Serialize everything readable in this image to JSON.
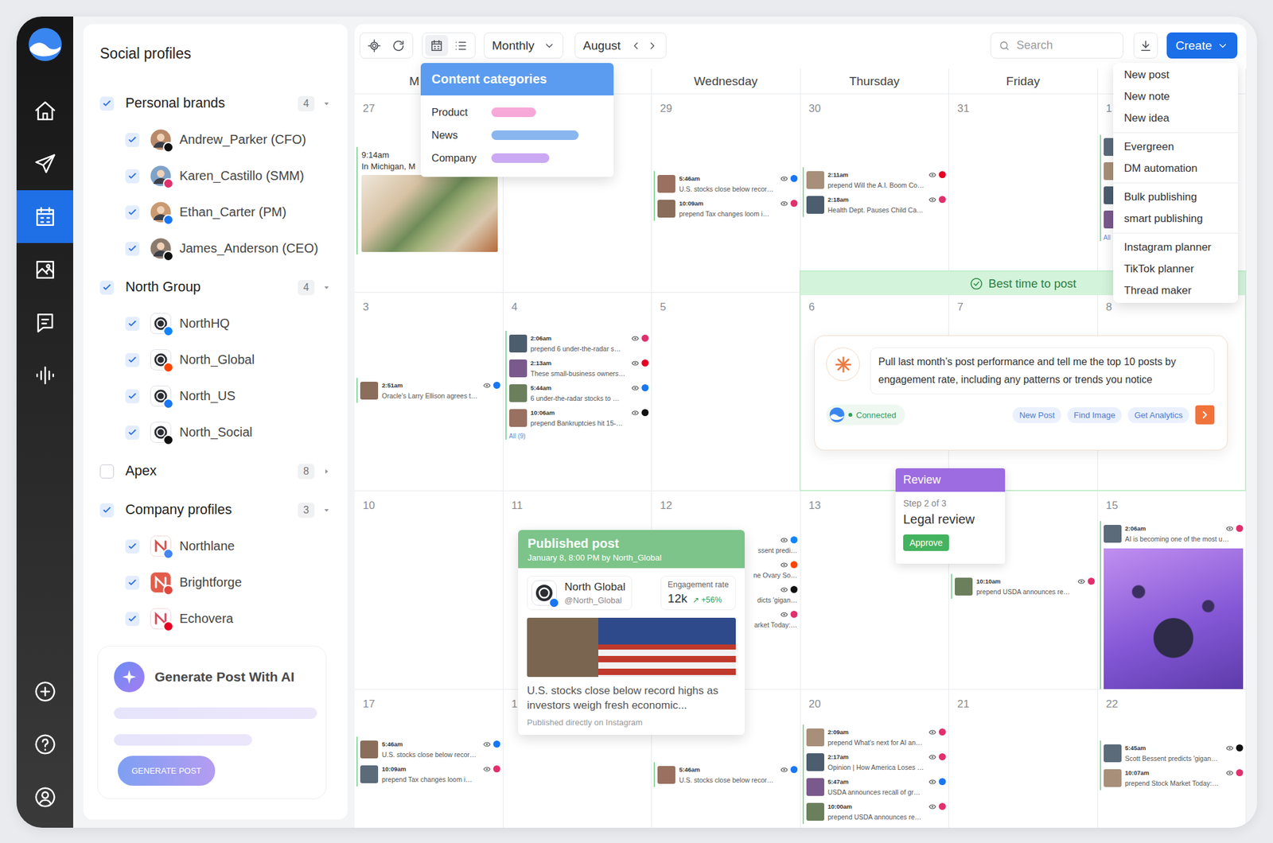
{
  "nav": {
    "top": [
      {
        "selected": false
      },
      {
        "selected": false
      },
      {
        "selected": true
      },
      {
        "selected": false
      },
      {
        "selected": false
      },
      {
        "selected": false
      }
    ],
    "bottom": [
      {
        "selected": false
      },
      {
        "selected": false
      },
      {
        "selected": false
      }
    ]
  },
  "sidebar": {
    "title": "Social profiles",
    "groups": [
      {
        "label": "Personal brands",
        "count": "4",
        "checked": true,
        "expanded": true,
        "profiles": [
          {
            "name": "Andrew_Parker (CFO)",
            "kind": "person",
            "checked": true,
            "badge_color": "#111111"
          },
          {
            "name": "Karen_Castillo (SMM)",
            "kind": "person",
            "checked": true,
            "badge_color": "#e1306c"
          },
          {
            "name": "Ethan_Carter (PM)",
            "kind": "person",
            "checked": true,
            "badge_color": "#1877f2"
          },
          {
            "name": "James_Anderson (CEO)",
            "kind": "person",
            "checked": true,
            "badge_color": "#111111"
          }
        ]
      },
      {
        "label": "North Group",
        "count": "4",
        "checked": true,
        "expanded": true,
        "profiles": [
          {
            "name": "NorthHQ",
            "kind": "brand",
            "checked": true,
            "badge_color": "#1185fe"
          },
          {
            "name": "North_Global",
            "kind": "brand",
            "checked": true,
            "badge_color": "#ff4500"
          },
          {
            "name": "North_US",
            "kind": "brand",
            "checked": true,
            "badge_color": "#1877f2"
          },
          {
            "name": "North_Social",
            "kind": "brand",
            "checked": true,
            "badge_color": "#111111"
          }
        ]
      },
      {
        "label": "Apex",
        "count": "8",
        "checked": false,
        "expanded": false,
        "profiles": []
      },
      {
        "label": "Company profiles",
        "count": "3",
        "checked": true,
        "expanded": true,
        "profiles": [
          {
            "name": "Northlane",
            "kind": "company",
            "checked": true,
            "badge_color": "#4285f4"
          },
          {
            "name": "Brightforge",
            "kind": "company",
            "checked": true,
            "badge_color": "#e0483e"
          },
          {
            "name": "Echovera",
            "kind": "company",
            "checked": true,
            "badge_color": "#e60023"
          }
        ]
      }
    ],
    "ai_card": {
      "title": "Generate Post With AI",
      "button": "GENERATE POST"
    }
  },
  "toolbar": {
    "view_buttons": [
      {
        "selected": true
      },
      {
        "selected": false
      }
    ],
    "view_mode": "Monthly",
    "month": "August",
    "search_placeholder": "Search",
    "create_label": "Create"
  },
  "calendar": {
    "headers": [
      "M",
      "",
      "Wednesday",
      "Thursday",
      "Friday",
      ""
    ],
    "weeks": [
      [
        {
          "date": "27",
          "posts": [
            {
              "kind": "card",
              "time": "9:14am",
              "text": "In Michigan, M"
            }
          ]
        },
        {
          "posts": []
        },
        {
          "date": "29",
          "posts": [
            {
              "kind": "line",
              "time": "5:46am",
              "text": "U.S. stocks close below recor…",
              "badge_color": "#1877f2"
            },
            {
              "kind": "line",
              "time": "10:09am",
              "text": "prepend Tax changes loom i…",
              "badge_color": "#e1306c"
            }
          ]
        },
        {
          "date": "30",
          "posts": [
            {
              "kind": "line",
              "time": "2:11am",
              "text": "prepend Will the A.I. Boom Co…",
              "badge_color": "#e60023"
            },
            {
              "kind": "line",
              "time": "2:18am",
              "text": "Health Dept. Pauses Child Ca…",
              "badge_color": "#e1306c"
            }
          ]
        },
        {
          "date": "31",
          "posts": []
        },
        {
          "date": "1",
          "posts": [
            {
              "kind": "thumb"
            },
            {
              "kind": "thumb"
            },
            {
              "kind": "thumb"
            },
            {
              "kind": "thumb"
            }
          ],
          "more": "All"
        }
      ],
      [
        {
          "date": "3",
          "posts": [
            {
              "kind": "line",
              "time": "2:51am",
              "text": "Oracle's Larry Ellison agrees t…",
              "badge_color": "#1877f2"
            }
          ]
        },
        {
          "date": "4",
          "posts": [
            {
              "kind": "line",
              "time": "2:06am",
              "text": "prepend 6 under-the-radar s…",
              "badge_color": "#e1306c"
            },
            {
              "kind": "line",
              "time": "2:13am",
              "text": "These small-business owners…",
              "badge_color": "#e60023"
            },
            {
              "kind": "line",
              "time": "5:44am",
              "text": "6 under-the-radar stocks to …",
              "badge_color": "#1877f2"
            },
            {
              "kind": "line",
              "time": "10:06am",
              "text": "prepend Bankruptcies hit 15-…",
              "badge_color": "#111111"
            }
          ],
          "more": "All (9)"
        },
        {
          "date": "5",
          "posts": []
        },
        {
          "date": "6",
          "posts": []
        },
        {
          "date": "7",
          "posts": []
        },
        {
          "date": "8",
          "posts": []
        }
      ],
      [
        {
          "date": "10",
          "posts": []
        },
        {
          "date": "11",
          "posts": []
        },
        {
          "date": "12",
          "posts": [
            {
              "kind": "clipped",
              "text": "ssent predi…",
              "badge_color": "#1185fe"
            },
            {
              "kind": "clipped",
              "text": "ne Ovary So…",
              "badge_color": "#ff4500"
            },
            {
              "kind": "clipped",
              "text": "dicts 'gigan…",
              "badge_color": "#111111"
            },
            {
              "kind": "clipped",
              "text": "arket Today:…",
              "badge_color": "#e1306c"
            }
          ]
        },
        {
          "date": "13",
          "posts": []
        },
        {
          "posts": [
            {
              "kind": "line",
              "time": "10:10am",
              "text": "prepend USDA announces re…",
              "badge_color": "#e1306c"
            }
          ]
        },
        {
          "date": "15",
          "posts": [
            {
              "kind": "feature",
              "time": "2:06am",
              "text": "AI is becoming one of the most u…",
              "badge_color": "#e1306c"
            }
          ]
        }
      ],
      [
        {
          "date": "17",
          "posts": [
            {
              "kind": "line",
              "time": "5:46am",
              "text": "U.S. stocks close below recor…",
              "badge_color": "#1877f2"
            },
            {
              "kind": "line",
              "time": "10:09am",
              "text": "prepend Tax changes loom i…",
              "badge_color": "#e1306c"
            }
          ]
        },
        {
          "date": "1",
          "posts": []
        },
        {
          "posts": [
            {
              "kind": "line",
              "time": "5:46am",
              "text": "U.S. stocks close below recor…",
              "badge_color": "#1877f2"
            }
          ]
        },
        {
          "date": "20",
          "posts": [
            {
              "kind": "line",
              "time": "2:09am",
              "text": "prepend What's next for AI an…",
              "badge_color": "#e1306c"
            },
            {
              "kind": "line",
              "time": "2:17am",
              "text": "Opinion | How America Loses …",
              "badge_color": "#e1306c"
            },
            {
              "kind": "line",
              "time": "5:47am",
              "text": "USDA announces recall of gr…",
              "badge_color": "#1877f2"
            },
            {
              "kind": "line",
              "time": "10:00am",
              "text": "prepend USDA announces re…",
              "badge_color": "#e1306c"
            }
          ]
        },
        {
          "date": "21",
          "posts": []
        },
        {
          "date": "22",
          "posts": [
            {
              "kind": "line",
              "time": "5:45am",
              "text": "Scott Bessent predicts 'gigan…",
              "badge_color": "#111111"
            },
            {
              "kind": "line",
              "time": "10:07am",
              "text": "prepend Stock Market Today:…",
              "badge_color": "#e1306c"
            }
          ]
        }
      ]
    ]
  },
  "categories": {
    "title": "Content categories",
    "items": [
      {
        "label": "Product",
        "color": "#f7a8d9",
        "level": 0.4
      },
      {
        "label": "News",
        "color": "#8ab6f0",
        "level": 0.78
      },
      {
        "label": "Company",
        "color": "#caa8f3",
        "level": 0.52
      }
    ]
  },
  "create_menu": [
    [
      "New post",
      "New note",
      "New idea"
    ],
    [
      "Evergreen",
      "DM automation"
    ],
    [
      "Bulk publishing",
      "smart publishing"
    ],
    [
      "Instagram planner",
      "TikTok planner",
      "Thread maker"
    ]
  ],
  "best_time": {
    "label": "Best time to post"
  },
  "ai_prompt": {
    "text": "Pull last month’s post performance and tell me the top 10 posts by engagement rate, including any patterns or trends you notice",
    "status": "Connected",
    "connected": true,
    "chips": [
      "New Post",
      "Find Image",
      "Get Analytics"
    ]
  },
  "review": {
    "header": "Review",
    "step": "Step 2 of 3",
    "title": "Legal review",
    "button": "Approve"
  },
  "published": {
    "header": "Published post",
    "meta": "January 8, 8:00 PM by North_Global",
    "account": "North Global",
    "handle": "@North_Global",
    "badge_color": "#1877f2",
    "metric_label": "Engagement rate",
    "metric_value": "12k",
    "metric_change": "↗ +56%",
    "text": "U.S. stocks close below record highs as investors weigh fresh economic...",
    "footer": "Published directly on Instagram"
  }
}
